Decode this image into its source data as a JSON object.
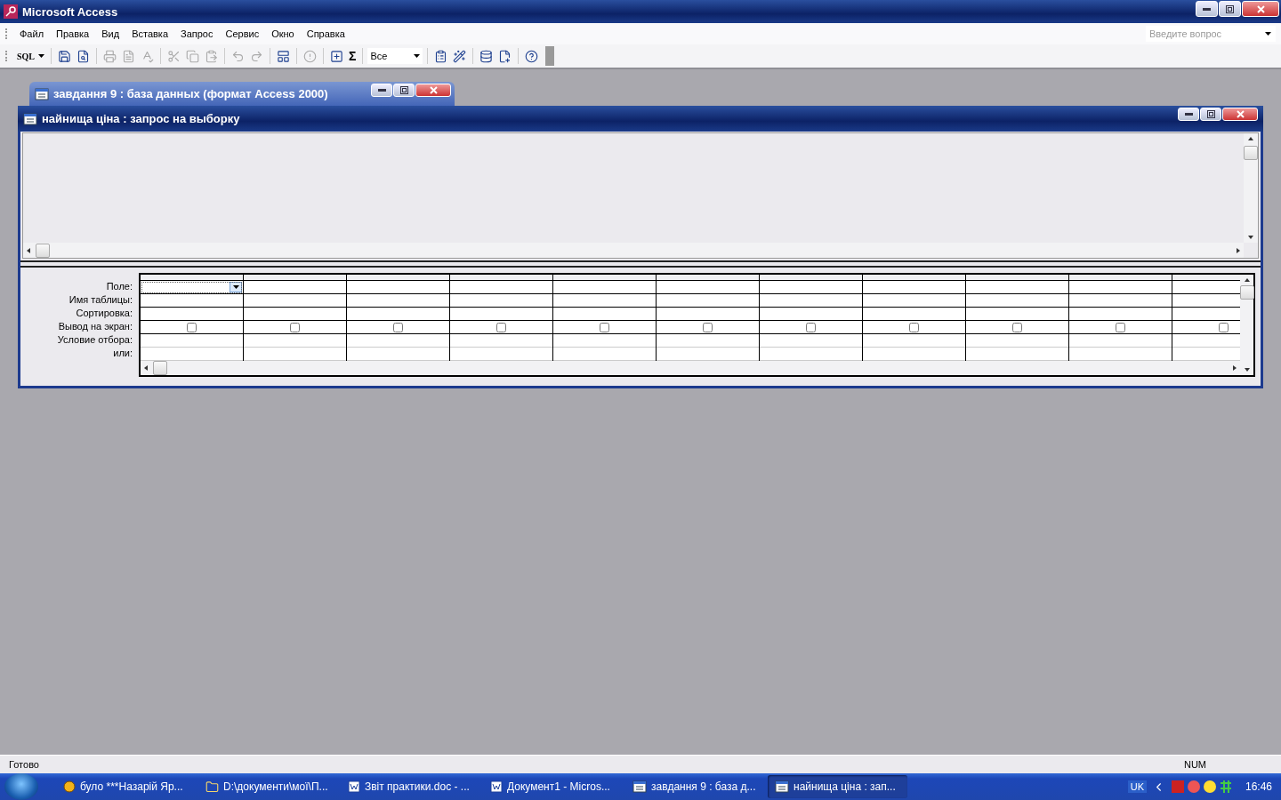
{
  "app": {
    "title": "Microsoft Access"
  },
  "menu": [
    {
      "label": "Файл"
    },
    {
      "label": "Правка"
    },
    {
      "label": "Вид"
    },
    {
      "label": "Вставка"
    },
    {
      "label": "Запрос"
    },
    {
      "label": "Сервис"
    },
    {
      "label": "Окно"
    },
    {
      "label": "Справка"
    }
  ],
  "help_search": {
    "placeholder": "Введите вопрос"
  },
  "toolbar": [
    {
      "kind": "sql",
      "label": "SQL",
      "disabled": false
    },
    {
      "kind": "sep"
    },
    {
      "kind": "save",
      "disabled": false
    },
    {
      "kind": "search",
      "disabled": false
    },
    {
      "kind": "sep"
    },
    {
      "kind": "print",
      "disabled": true
    },
    {
      "kind": "preview",
      "disabled": true
    },
    {
      "kind": "spell",
      "disabled": true
    },
    {
      "kind": "sep"
    },
    {
      "kind": "cut",
      "disabled": true
    },
    {
      "kind": "copy",
      "disabled": true
    },
    {
      "kind": "paste",
      "disabled": true
    },
    {
      "kind": "sep"
    },
    {
      "kind": "undo",
      "disabled": true
    },
    {
      "kind": "redo",
      "disabled": true
    },
    {
      "kind": "sep"
    },
    {
      "kind": "querytype",
      "disabled": false
    },
    {
      "kind": "sep"
    },
    {
      "kind": "run",
      "disabled": true
    },
    {
      "kind": "sep"
    },
    {
      "kind": "addtable",
      "disabled": false
    },
    {
      "kind": "text",
      "label": "Σ",
      "disabled": false
    },
    {
      "kind": "sep"
    },
    {
      "kind": "combo",
      "label": "Все",
      "disabled": false
    },
    {
      "kind": "sep"
    },
    {
      "kind": "properties",
      "disabled": false
    },
    {
      "kind": "builder",
      "disabled": false
    },
    {
      "kind": "sep"
    },
    {
      "kind": "dbwindow",
      "disabled": false
    },
    {
      "kind": "newobject",
      "disabled": false
    },
    {
      "kind": "sep"
    },
    {
      "kind": "help",
      "disabled": false
    }
  ],
  "db_window": {
    "title": "завдання 9 : база данных (формат Access 2000)"
  },
  "query_window": {
    "title": "найнища ціна : запрос на выборку",
    "row_labels": [
      "Поле:",
      "Имя таблицы:",
      "Сортировка:",
      "Вывод на экран:",
      "Условие отбора:",
      "или:"
    ],
    "columns": [
      {
        "selected": true,
        "show": false
      },
      {
        "selected": false,
        "show": false
      },
      {
        "selected": false,
        "show": false
      },
      {
        "selected": false,
        "show": false
      },
      {
        "selected": false,
        "show": false
      },
      {
        "selected": false,
        "show": false
      },
      {
        "selected": false,
        "show": false
      },
      {
        "selected": false,
        "show": false
      },
      {
        "selected": false,
        "show": false
      },
      {
        "selected": false,
        "show": false
      },
      {
        "selected": false,
        "show": false
      }
    ]
  },
  "status_bar": {
    "text": "Готово",
    "indicator": "NUM"
  },
  "taskbar": {
    "buttons": [
      {
        "label": "було ***Назарій Яр...",
        "kind": "messenger",
        "selected": false
      },
      {
        "label": "D:\\документи\\мої\\П...",
        "kind": "folder",
        "selected": false
      },
      {
        "label": "Звіт практики.doc - ...",
        "kind": "word",
        "selected": false
      },
      {
        "label": "Документ1 - Micros...",
        "kind": "word",
        "selected": false
      },
      {
        "label": "завдання 9 : база д...",
        "kind": "database",
        "selected": false
      },
      {
        "label": "найнища ціна : зап...",
        "kind": "query",
        "selected": true
      }
    ],
    "language": "UK",
    "clock": "16:46"
  }
}
